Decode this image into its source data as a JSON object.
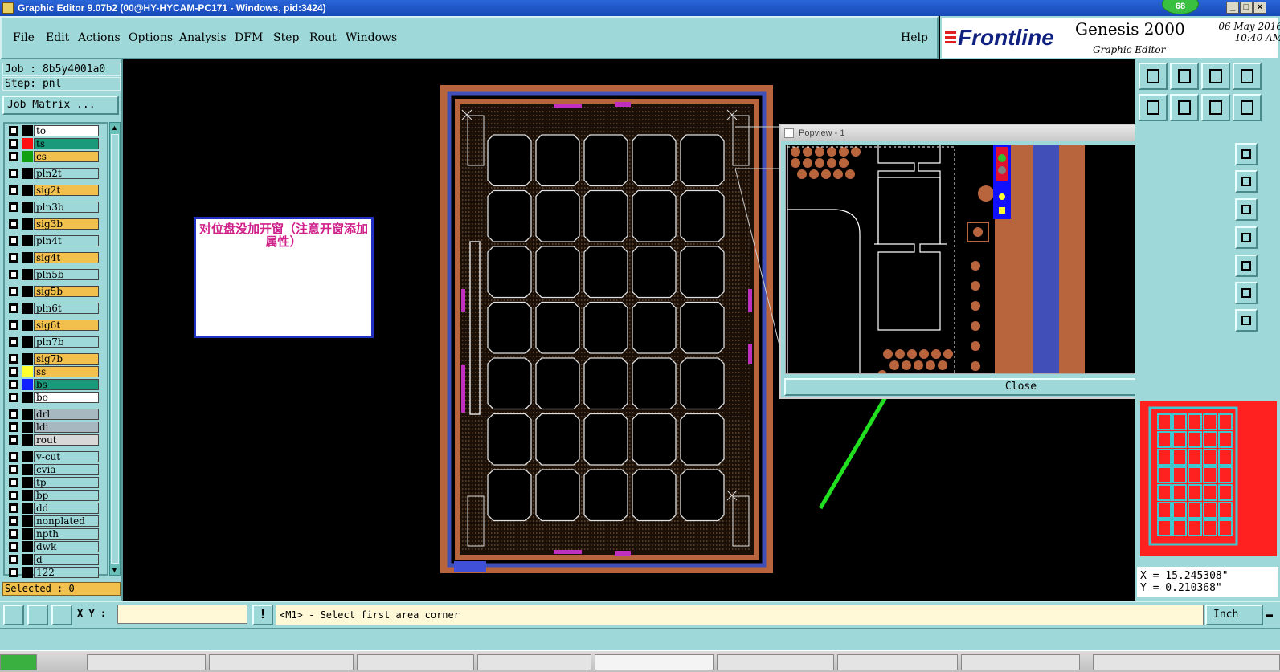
{
  "window": {
    "title": "Graphic Editor 9.07b2 (00@HY-HYCAM-PC171 - Windows, pid:3424)",
    "notification_count": "68"
  },
  "menubar": {
    "items": [
      "File",
      "Edit",
      "Actions",
      "Options",
      "Analysis",
      "DFM",
      "Step",
      "Rout",
      "Windows"
    ],
    "help": "Help"
  },
  "logo": {
    "brand": "Frontline",
    "product": "Genesis 2000",
    "subtitle": "Graphic Editor",
    "date": "06 May 2016",
    "time": "10:40 AM"
  },
  "job": {
    "job": "Job : 8b5y4001a0",
    "step": "Step: pnl",
    "job_matrix": "Job Matrix ...",
    "selected": "Selected : 0"
  },
  "layers": [
    {
      "name": "to",
      "bg": "#ffffff",
      "swatch": "#000000"
    },
    {
      "name": "ts",
      "bg": "#1a9a7a",
      "swatch": "#ff1010"
    },
    {
      "name": "cs",
      "bg": "#f2c04c",
      "swatch": "#10a010"
    },
    {
      "name": "pln2t",
      "bg": "#9ed8d8",
      "swatch": "#000000"
    },
    {
      "name": "sig2t",
      "bg": "#f2c04c",
      "swatch": "#000000"
    },
    {
      "name": "pln3b",
      "bg": "#9ed8d8",
      "swatch": "#000000"
    },
    {
      "name": "sig3b",
      "bg": "#f2c04c",
      "swatch": "#000000"
    },
    {
      "name": "pln4t",
      "bg": "#9ed8d8",
      "swatch": "#000000"
    },
    {
      "name": "sig4t",
      "bg": "#f2c04c",
      "swatch": "#000000"
    },
    {
      "name": "pln5b",
      "bg": "#9ed8d8",
      "swatch": "#000000"
    },
    {
      "name": "sig5b",
      "bg": "#f2c04c",
      "swatch": "#000000"
    },
    {
      "name": "pln6t",
      "bg": "#9ed8d8",
      "swatch": "#000000"
    },
    {
      "name": "sig6t",
      "bg": "#f2c04c",
      "swatch": "#000000"
    },
    {
      "name": "pln7b",
      "bg": "#9ed8d8",
      "swatch": "#000000"
    },
    {
      "name": "sig7b",
      "bg": "#f2c04c",
      "swatch": "#000000"
    },
    {
      "name": "ss",
      "bg": "#f2c04c",
      "swatch": "#ffff30"
    },
    {
      "name": "bs",
      "bg": "#1a9a7a",
      "swatch": "#1020ff"
    },
    {
      "name": "bo",
      "bg": "#ffffff",
      "swatch": "#000000"
    },
    {
      "name": "drl",
      "bg": "#a8b8c0",
      "swatch": "#000000"
    },
    {
      "name": "ldi",
      "bg": "#a8b8c0",
      "swatch": "#000000"
    },
    {
      "name": "rout",
      "bg": "#d8d8d8",
      "swatch": "#000000"
    },
    {
      "name": "v-cut",
      "bg": "#9ed8d8",
      "swatch": "#000000"
    },
    {
      "name": "cvia",
      "bg": "#9ed8d8",
      "swatch": "#000000"
    },
    {
      "name": "tp",
      "bg": "#9ed8d8",
      "swatch": "#000000"
    },
    {
      "name": "bp",
      "bg": "#9ed8d8",
      "swatch": "#000000"
    },
    {
      "name": "dd",
      "bg": "#9ed8d8",
      "swatch": "#000000"
    },
    {
      "name": "nonplated",
      "bg": "#9ed8d8",
      "swatch": "#000000"
    },
    {
      "name": "npth",
      "bg": "#9ed8d8",
      "swatch": "#000000"
    },
    {
      "name": "dwk",
      "bg": "#9ed8d8",
      "swatch": "#000000"
    },
    {
      "name": "d",
      "bg": "#9ed8d8",
      "swatch": "#000000"
    },
    {
      "name": "122",
      "bg": "#9ed8d8",
      "swatch": "#000000"
    }
  ],
  "note": {
    "text": "对位盘没加开窗（注意开窗添加属性）"
  },
  "popview": {
    "title": "Popview - 1",
    "close_label": "Close"
  },
  "coords": {
    "x": "X = 15.245308\"",
    "y": "Y = 0.210368\""
  },
  "bottom": {
    "xy_label": "X Y :",
    "xy_value": "",
    "message": "<M1> - Select first area corner",
    "unit": "Inch"
  },
  "colors": {
    "panel": "#9ed8d8",
    "copper": "#b8643c",
    "plane_blue": "#4050b8",
    "annotation_arrow": "#20e020"
  }
}
